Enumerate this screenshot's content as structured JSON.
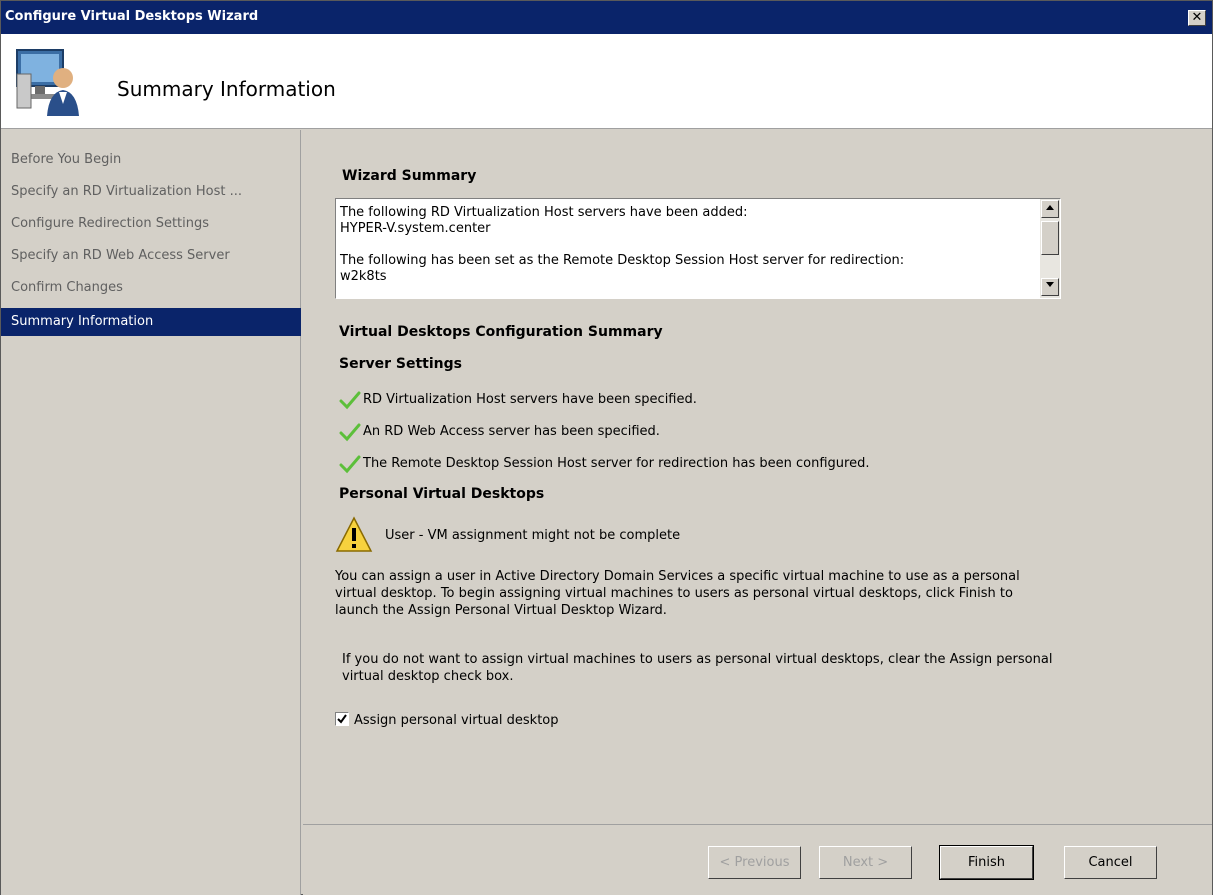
{
  "window": {
    "title": "Configure Virtual Desktops Wizard",
    "close_glyph": "✕"
  },
  "header": {
    "title": "Summary Information",
    "icon": "wizard-monitor-user-icon"
  },
  "sidebar": {
    "items": [
      {
        "label": "Before You Begin"
      },
      {
        "label": "Specify an RD Virtualization Host ..."
      },
      {
        "label": "Configure Redirection Settings"
      },
      {
        "label": "Specify an RD Web Access Server"
      },
      {
        "label": "Confirm Changes"
      },
      {
        "label": "Summary Information"
      }
    ]
  },
  "main": {
    "wizard_summary_title": "Wizard Summary",
    "wizard_summary_text": "The following RD Virtualization Host servers have been added:\nHYPER-V.system.center\n\nThe following has been set as the Remote Desktop Session Host server for redirection:\nw2k8ts",
    "config_summary_title": "Virtual Desktops Configuration Summary",
    "server_settings_title": "Server Settings",
    "server_settings": [
      {
        "text": "RD Virtualization Host servers have been specified.",
        "icon": "checkmark-icon"
      },
      {
        "text": "An RD Web Access server has been specified.",
        "icon": "checkmark-icon"
      },
      {
        "text": "The Remote Desktop Session Host server for redirection has been configured.",
        "icon": "checkmark-icon"
      }
    ],
    "personal_title": "Personal Virtual Desktops",
    "warning_text": "User - VM assignment might not be complete",
    "para1": "You can assign a user in Active Directory Domain Services a specific virtual machine to use as a personal virtual desktop. To begin assigning virtual machines to users as personal virtual desktops, click Finish to launch the Assign Personal Virtual Desktop Wizard.",
    "para2": "If you do not want to assign virtual machines to users as personal virtual desktops, clear the Assign personal virtual desktop check box.",
    "checkbox_label": "Assign personal virtual desktop",
    "checkbox_checked": true
  },
  "footer": {
    "previous_label": "< Previous",
    "next_label": "Next >",
    "finish_label": "Finish",
    "cancel_label": "Cancel"
  }
}
